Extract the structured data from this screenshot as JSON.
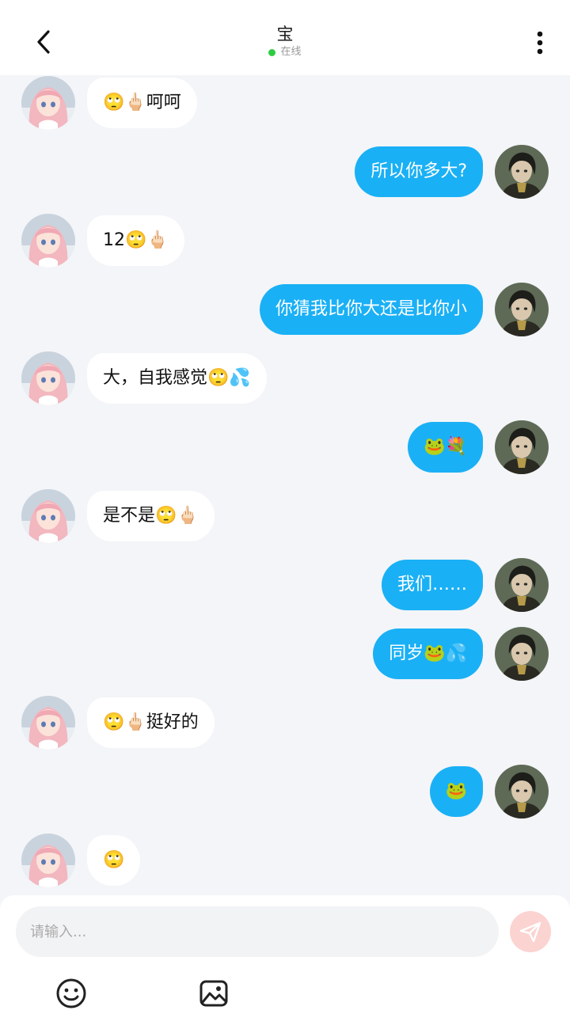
{
  "header": {
    "title": "宝",
    "status": "在线",
    "back_icon": "chevron-left-icon",
    "more_icon": "vertical-dots-icon"
  },
  "messages": [
    {
      "side": "in",
      "text": "🙄🖕🏻呵呵"
    },
    {
      "side": "out",
      "text": "所以你多大?"
    },
    {
      "side": "in",
      "text": "12🙄🖕🏻"
    },
    {
      "side": "out",
      "text": "你猜我比你大还是比你小"
    },
    {
      "side": "in",
      "text": "大，自我感觉🙄💦"
    },
    {
      "side": "out",
      "text": "🐸💐"
    },
    {
      "side": "in",
      "text": "是不是🙄🖕🏻"
    },
    {
      "side": "out",
      "text": "我们……"
    },
    {
      "side": "out",
      "text": "同岁🐸💦"
    },
    {
      "side": "in",
      "text": "🙄🖕🏻挺好的"
    },
    {
      "side": "out",
      "text": "🐸"
    },
    {
      "side": "in",
      "text": "🙄"
    }
  ],
  "composer": {
    "placeholder": "请输入...",
    "send_icon": "send-icon",
    "emoji_icon": "emoji-icon",
    "image_icon": "image-icon"
  },
  "colors": {
    "outgoing_bubble": "#1ab0f5",
    "incoming_bubble": "#ffffff",
    "background": "#f3f5f8",
    "online_dot": "#2ecc40",
    "send_button": "#fbd3d0"
  }
}
